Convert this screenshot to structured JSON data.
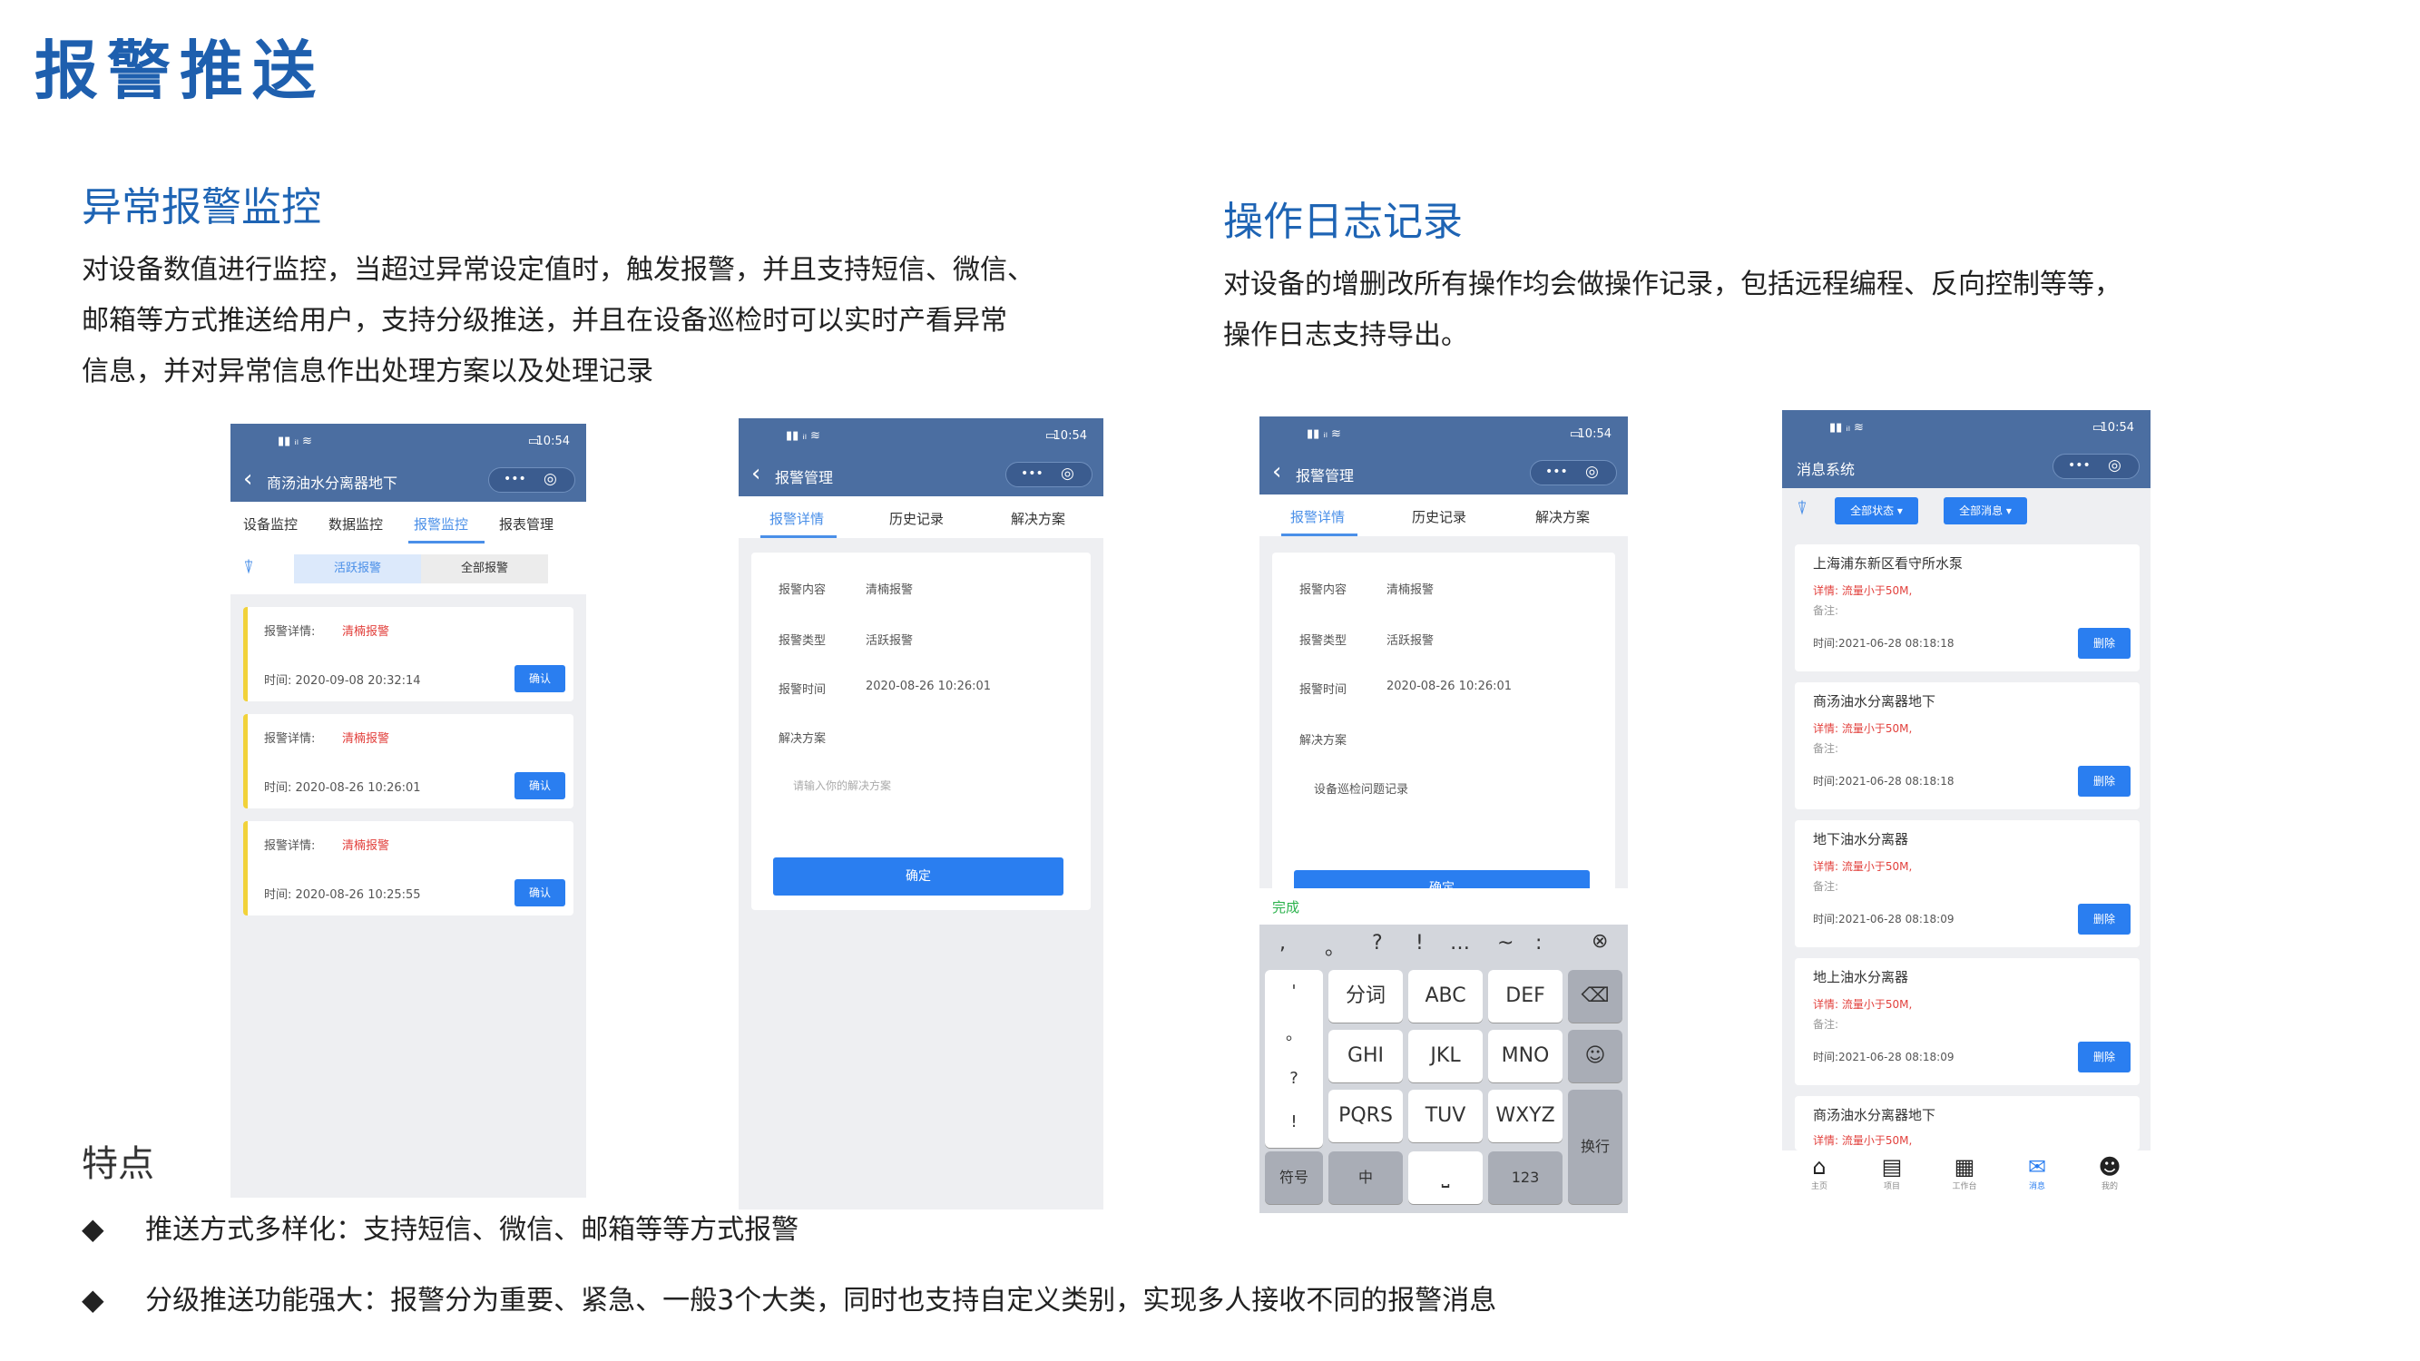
{
  "page": {
    "title": "报警推送",
    "section1": {
      "title": "异常报警监控",
      "lines": [
        "对设备数值进行监控，当超过异常设定值时，触发报警，并且支持短信、微信、",
        "邮箱等方式推送给用户，支持分级推送，并且在设备巡检时可以实时产看异常",
        "信息，并对异常信息作出处理方案以及处理记录"
      ]
    },
    "section2": {
      "title": "操作日志记录",
      "lines": [
        "对设备的增删改所有操作均会做操作记录，包括远程编程、反向控制等等，",
        "操作日志支持导出。"
      ]
    },
    "features": {
      "title": "特点",
      "bullet": "◆",
      "items": [
        "推送方式多样化：支持短信、微信、邮箱等等方式报警",
        "分级推送功能强大：报警分为重要、紧急、一般3个大类，同时也支持自定义类别，实现多人接收不同的报警消息"
      ]
    }
  },
  "status": {
    "time": "10:54",
    "signal": "▮▮ ᵢₗ ≋",
    "battery": "▭"
  },
  "capsule": {
    "dots": "•••",
    "target": "◎"
  },
  "phone1": {
    "back": "‹",
    "title": "商汤油水分离器地下",
    "tabs": [
      "设备监控",
      "数据监控",
      "报警监控",
      "报表管理"
    ],
    "filter_icon": "⍒",
    "toggle": [
      "活跃报警",
      "全部报警"
    ],
    "cards": [
      {
        "label": "报警详情:",
        "value": "清楠报警",
        "time": "时间: 2020-09-08 20:32:14",
        "btn": "确认"
      },
      {
        "label": "报警详情:",
        "value": "清楠报警",
        "time": "时间: 2020-08-26 10:26:01",
        "btn": "确认"
      },
      {
        "label": "报警详情:",
        "value": "清楠报警",
        "time": "时间: 2020-08-26 10:25:55",
        "btn": "确认"
      }
    ]
  },
  "phone2": {
    "back": "‹",
    "title": "报警管理",
    "tabs": [
      "报警详情",
      "历史记录",
      "解决方案"
    ],
    "rows": [
      {
        "label": "报警内容",
        "value": "清楠报警"
      },
      {
        "label": "报警类型",
        "value": "活跃报警"
      },
      {
        "label": "报警时间",
        "value": "2020-08-26 10:26:01"
      },
      {
        "label": "解决方案",
        "value": ""
      }
    ],
    "placeholder": "请输入你的解决方案",
    "confirm": "确定"
  },
  "phone3": {
    "back": "‹",
    "title": "报警管理",
    "tabs": [
      "报警详情",
      "历史记录",
      "解决方案"
    ],
    "rows": [
      {
        "label": "报警内容",
        "value": "清楠报警"
      },
      {
        "label": "报警类型",
        "value": "活跃报警"
      },
      {
        "label": "报警时间",
        "value": "2020-08-26 10:26:01"
      },
      {
        "label": "解决方案",
        "value": ""
      }
    ],
    "solution": "设备巡检问题记录",
    "confirm": "确定",
    "kb_done": "完成",
    "kb_punct": [
      ",",
      "。",
      "?",
      "!",
      "…",
      "~",
      ":"
    ],
    "kb_clear": "⊗",
    "kb_side": [
      "'",
      "。",
      "?",
      "!"
    ],
    "kb_keys": [
      "分词",
      "ABC",
      "DEF",
      "GHI",
      "JKL",
      "MNO",
      "PQRS",
      "TUV",
      "WXYZ"
    ],
    "kb_backspace": "⌫",
    "kb_emoji": "☺",
    "kb_enter": "换行",
    "kb_symbol": "符号",
    "kb_chinese": "中",
    "kb_space": "⎵",
    "kb_num": "123"
  },
  "phone4": {
    "title": "消息系统",
    "filter_icon": "⍒",
    "dropdowns": [
      "全部状态 ▾",
      "全部消息 ▾"
    ],
    "cards": [
      {
        "name": "上海浦东新区看守所水泵",
        "detail": "详情: 流量小于50M,",
        "note": "备注:",
        "time": "时间:2021-06-28 08:18:18",
        "btn": "删除"
      },
      {
        "name": "商汤油水分离器地下",
        "detail": "详情: 流量小于50M,",
        "note": "备注:",
        "time": "时间:2021-06-28 08:18:18",
        "btn": "删除"
      },
      {
        "name": "地下油水分离器",
        "detail": "详情: 流量小于50M,",
        "note": "备注:",
        "time": "时间:2021-06-28 08:18:09",
        "btn": "删除"
      },
      {
        "name": "地上油水分离器",
        "detail": "详情: 流量小于50M,",
        "note": "备注:",
        "time": "时间:2021-06-28 08:18:09",
        "btn": "删除"
      },
      {
        "name": "商汤油水分离器地下",
        "detail": "详情: 流量小于50M,",
        "note": "",
        "time": "",
        "btn": ""
      }
    ],
    "bottom_nav": [
      {
        "icon": "⌂",
        "label": "主页"
      },
      {
        "icon": "▤",
        "label": "项目"
      },
      {
        "icon": "▦",
        "label": "工作台"
      },
      {
        "icon": "✉",
        "label": "消息"
      },
      {
        "icon": "☻",
        "label": "我的"
      }
    ]
  },
  "colors": {
    "accent": "#1e5fae",
    "bar": "#4b6ea1",
    "button": "#2a7ef0",
    "alarm": "#e2403c",
    "stripe": "#f1d23a"
  }
}
